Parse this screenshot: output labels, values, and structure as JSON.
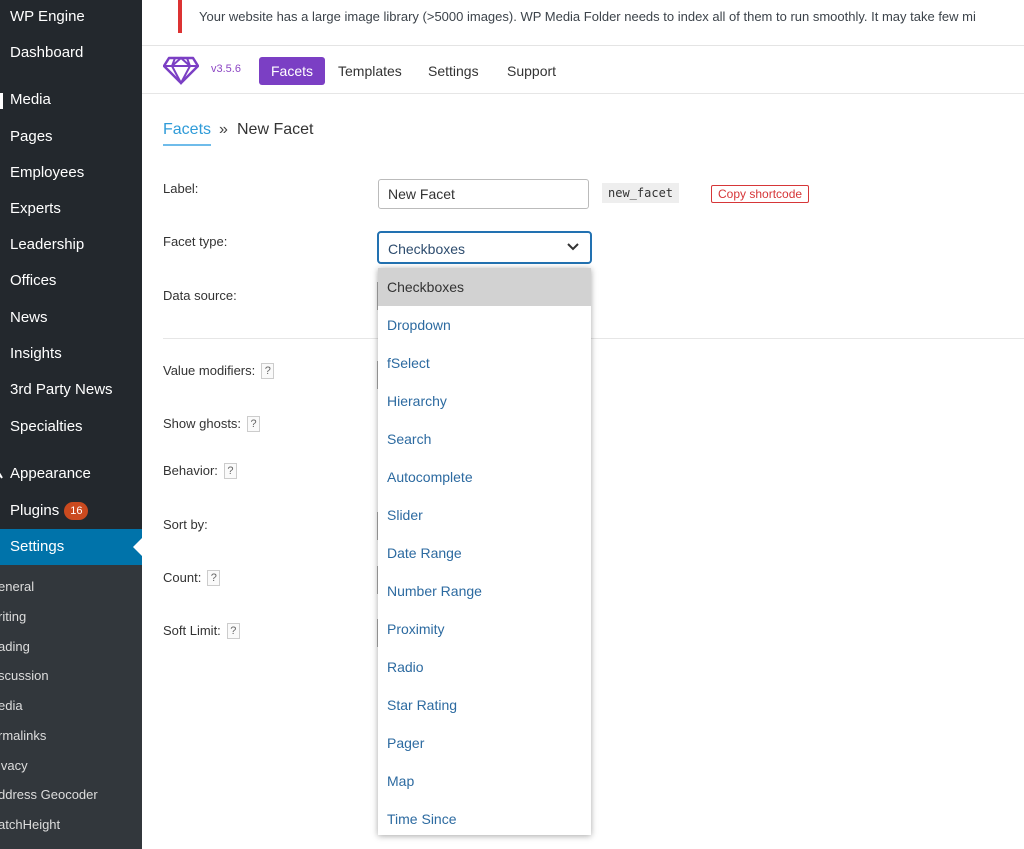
{
  "sidebar": {
    "items": [
      "WP Engine",
      "Dashboard",
      "Media",
      "Pages",
      "Employees",
      "Experts",
      "Leadership",
      "Offices",
      "News",
      "Insights",
      "3rd Party News",
      "Specialties",
      "Appearance",
      "Plugins",
      "Settings"
    ],
    "plugins_badge": "16",
    "submenu": [
      "eneral",
      "riting",
      "ading",
      "scussion",
      "edia",
      "rmalinks",
      "ivacy",
      "ddress Geocoder",
      "atchHeight"
    ]
  },
  "notice": "Your website has a large image library (>5000 images). WP Media Folder needs to index all of them to run smoothly. It may take few mi",
  "nav": {
    "version": "v3.5.6",
    "tabs": [
      "Facets",
      "Templates",
      "Settings",
      "Support"
    ]
  },
  "breadcrumb": {
    "link": "Facets",
    "sep": "»",
    "current": "New Facet"
  },
  "form": {
    "label_label": "Label:",
    "label_value": "New Facet",
    "shortcode_name": "new_facet",
    "copy_button": "Copy shortcode",
    "facet_type_label": "Facet type:",
    "facet_type_value": "Checkboxes",
    "data_source_label": "Data source:",
    "value_modifiers_label": "Value modifiers:",
    "show_ghosts_label": "Show ghosts:",
    "behavior_label": "Behavior:",
    "sort_by_label": "Sort by:",
    "count_label": "Count:",
    "soft_limit_label": "Soft Limit:",
    "help_glyph": "?"
  },
  "dropdown_options": [
    "Checkboxes",
    "Dropdown",
    "fSelect",
    "Hierarchy",
    "Search",
    "Autocomplete",
    "Slider",
    "Date Range",
    "Number Range",
    "Proximity",
    "Radio",
    "Star Rating",
    "Pager",
    "Map",
    "Time Since"
  ],
  "colors": {
    "sidebar_bg": "#23282d",
    "active": "#0073aa",
    "accent_purple": "#7b3fc4",
    "link_blue": "#2f9bd8",
    "notice_red": "#dc3232"
  }
}
